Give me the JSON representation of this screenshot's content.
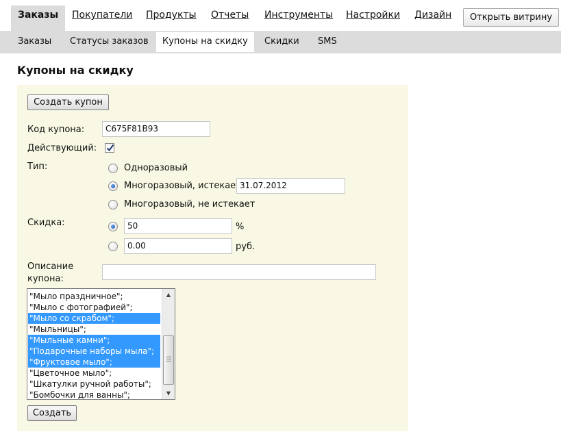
{
  "top_nav": {
    "tabs": [
      {
        "label": "Заказы",
        "active": true
      },
      {
        "label": "Покупатели"
      },
      {
        "label": "Продукты"
      },
      {
        "label": "Отчеты"
      },
      {
        "label": "Инструменты"
      },
      {
        "label": "Настройки"
      },
      {
        "label": "Дизайн"
      }
    ],
    "open_store_label": "Открыть витрину"
  },
  "sub_nav": {
    "tabs": [
      {
        "label": "Заказы"
      },
      {
        "label": "Статусы заказов"
      },
      {
        "label": "Купоны на скидку",
        "active": true
      },
      {
        "label": "Скидки"
      },
      {
        "label": "SMS"
      }
    ]
  },
  "page": {
    "title": "Купоны на скидку"
  },
  "form": {
    "create_coupon_label": "Создать купон",
    "code_label": "Код купона:",
    "code_value": "C675F81B93",
    "active_label": "Действующий:",
    "active_checked": true,
    "type_label": "Тип:",
    "type_options": [
      {
        "label": "Одноразовый",
        "selected": false
      },
      {
        "label": "Многоразовый, истекает",
        "selected": true
      },
      {
        "label": "Многоразовый, не истекает",
        "selected": false
      }
    ],
    "expires_value": "31.07.2012",
    "discount_label": "Скидка:",
    "discount_percent_value": "50",
    "discount_percent_unit": "%",
    "discount_amount_value": "0.00",
    "discount_amount_unit": "руб.",
    "description_label_line1": "Описание",
    "description_label_line2": "купона:",
    "description_value": "",
    "categories": [
      {
        "label": "\"Мыло праздничное\";",
        "selected": false
      },
      {
        "label": "\"Мыло с фотографией\";",
        "selected": false
      },
      {
        "label": "\"Мыло со скрабом\";",
        "selected": true
      },
      {
        "label": "\"Мыльницы\";",
        "selected": false
      },
      {
        "label": "\"Мыльные камни\";",
        "selected": true
      },
      {
        "label": "\"Подарочные наборы мыла\";",
        "selected": true
      },
      {
        "label": "\"Фруктовое мыло\";",
        "selected": true
      },
      {
        "label": "\"Цветочное мыло\";",
        "selected": false
      },
      {
        "label": "\"Шкатулки ручной работы\";",
        "selected": false
      },
      {
        "label": "\"Бомбочки для ванны\";",
        "selected": false
      }
    ],
    "submit_label": "Создать"
  },
  "colors": {
    "panel_bg": "#f8f8e4",
    "nav_bg": "#dcdcdc",
    "selection": "#3399ff"
  }
}
